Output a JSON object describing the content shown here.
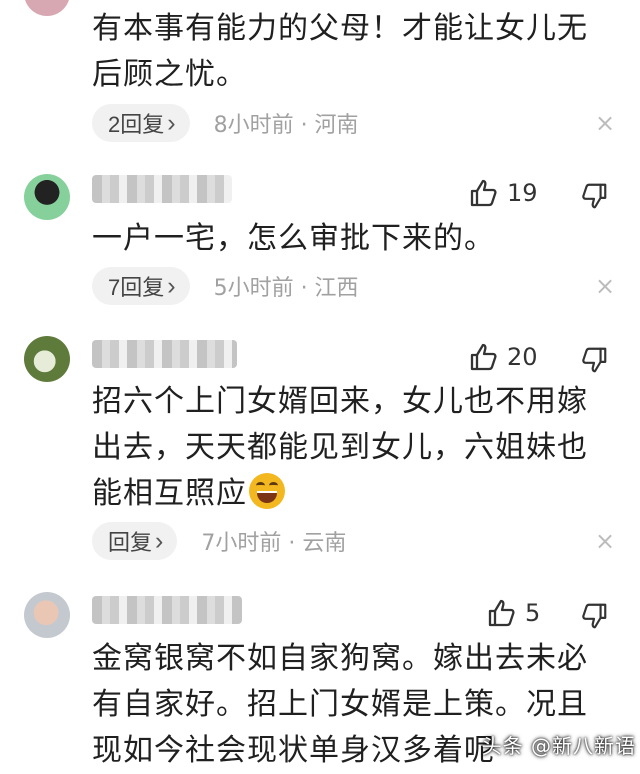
{
  "comments": [
    {
      "text": "有本事有能力的父母！才能让女儿无后顾之忧。",
      "reply_label": "2回复",
      "meta": "8小时前 · 河南"
    },
    {
      "likes": "19",
      "text": "一户一宅，怎么审批下来的。",
      "reply_label": "7回复",
      "meta": "5小时前 · 江西"
    },
    {
      "likes": "20",
      "text": "招六个上门女婿回来，女儿也不用嫁出去，天天都能见到女儿，六姐妹也能相互照应",
      "reply_label": "回复",
      "meta": "7小时前 · 云南"
    },
    {
      "likes": "5",
      "text": "金窝银窝不如自家狗窝。嫁出去未必有自家好。招上门女婿是上策。况且现如今社会现状单身汉多着呢"
    }
  ],
  "icons": {
    "thumb_up": "thumb-up-icon",
    "thumb_down": "thumb-down-icon",
    "close": "close-icon",
    "reply_chevron": "chevron-right-icon"
  },
  "watermark": "头条 @新八新语"
}
